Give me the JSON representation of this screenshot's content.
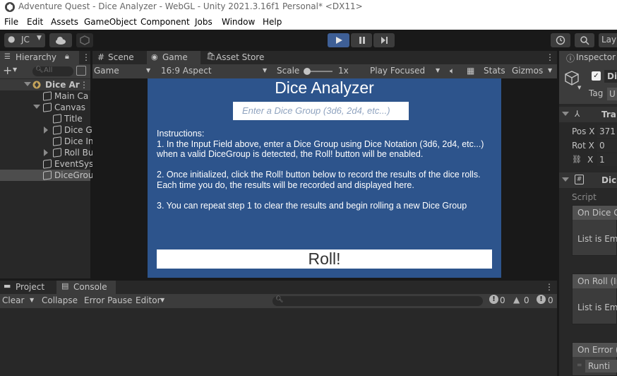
{
  "window": {
    "title": "Adventure Quest - Dice Analyzer - WebGL - Unity 2021.3.16f1 Personal* <DX11>"
  },
  "menu": [
    "File",
    "Edit",
    "Assets",
    "GameObject",
    "Component",
    "Jobs",
    "Window",
    "Help"
  ],
  "toolbar": {
    "account": "JC",
    "layers": "Lay"
  },
  "hierarchy": {
    "tab": "Hierarchy",
    "search_placeholder": "All",
    "items": [
      {
        "label": "Dice Ar",
        "indent": 0,
        "icon": "unity-icon",
        "expanded": true
      },
      {
        "label": "Main Ca",
        "indent": 1
      },
      {
        "label": "Canvas",
        "indent": 1,
        "expanded": true
      },
      {
        "label": "Title",
        "indent": 2
      },
      {
        "label": "Dice G",
        "indent": 2,
        "collapsed": true
      },
      {
        "label": "Dice In",
        "indent": 2
      },
      {
        "label": "Roll Bu",
        "indent": 2,
        "collapsed": true
      },
      {
        "label": "EventSys",
        "indent": 1
      },
      {
        "label": "DiceGrou",
        "indent": 1,
        "selected": true
      }
    ]
  },
  "tabs": {
    "scene": "Scene",
    "game": "Game",
    "asset_store": "Asset Store"
  },
  "game_toolbar": {
    "display": "Game",
    "aspect": "16:9 Aspect",
    "scale_label": "Scale",
    "scale_value": "1x",
    "play_focused": "Play Focused",
    "stats": "Stats",
    "gizmos": "Gizmos"
  },
  "game": {
    "title": "Dice Analyzer",
    "input_placeholder": "Enter a Dice Group (3d6, 2d4, etc...)",
    "instructions": [
      "Instructions:",
      "1. In the Input Field above, enter a Dice Group using Dice Notation (3d6, 2d4, etc...)",
      "when a valid DiceGroup is detected, the Roll! button will be enabled.",
      "",
      "2. Once initialized, click the Roll! button below to record the results of the dice rolls.",
      "Each time you do, the results will be recorded and displayed here.",
      "",
      "3. You can repeat step 1 to clear the results and begin rolling a new Dice Group"
    ],
    "roll_button": "Roll!"
  },
  "console": {
    "project_tab": "Project",
    "console_tab": "Console",
    "clear": "Clear",
    "collapse": "Collapse",
    "error_pause": "Error Pause",
    "editor": "Editor",
    "count_info": "0",
    "count_warn": "0",
    "count_error": "0"
  },
  "inspector": {
    "tab": "Inspector",
    "object_name": "Di",
    "tag_label": "Tag",
    "tag_value": "U",
    "transform": "Tra",
    "pos_label": "Pos X",
    "pos_value": "371",
    "rot_label": "Rot X",
    "rot_value": "0",
    "scale_label": "X",
    "scale_value": "1",
    "component": "Dice",
    "script_label": "Script",
    "events": [
      {
        "title": "On Dice G",
        "empty": "List is Emp"
      },
      {
        "title": "On Roll (In",
        "empty": "List is Emp"
      },
      {
        "title": "On Error (S",
        "runtime": "Runti"
      }
    ]
  },
  "colors": {
    "accent": "#3e5f96",
    "game_bg": "#2d548c",
    "selection": "#4d4d4d"
  }
}
